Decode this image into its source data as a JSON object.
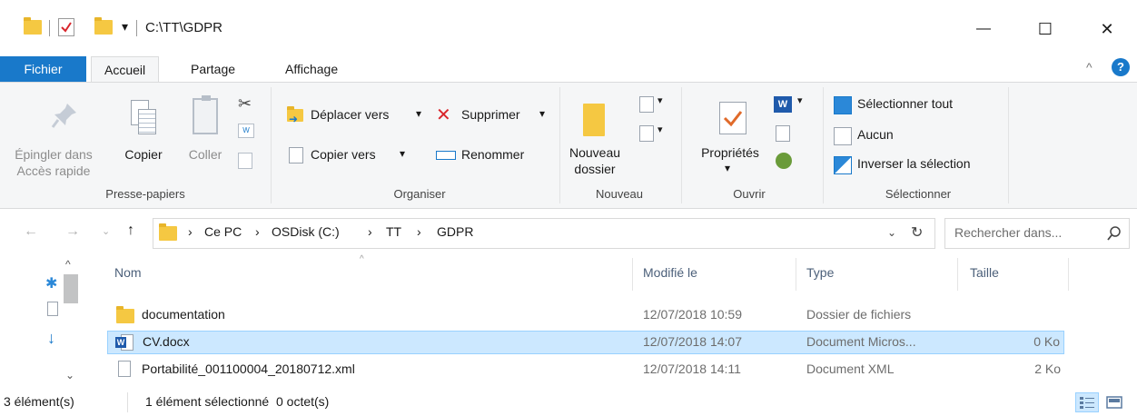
{
  "window": {
    "title": "C:\\TT\\GDPR",
    "qat_dropdown": "▾",
    "controls": {
      "minimize": "—",
      "maximize": "☐",
      "close": "✕"
    }
  },
  "tabs": [
    {
      "label": "Fichier"
    },
    {
      "label": "Accueil"
    },
    {
      "label": "Partage"
    },
    {
      "label": "Affichage"
    }
  ],
  "ribbon": {
    "groups": {
      "clipboard": {
        "label": "Presse-papiers",
        "pin": "Épingler dans\nAccès rapide",
        "pin_line1": "Épingler dans",
        "pin_line2": "Accès rapide",
        "copy": "Copier",
        "paste": "Coller"
      },
      "organize": {
        "label": "Organiser",
        "move_to": "Déplacer vers",
        "copy_to": "Copier vers",
        "delete": "Supprimer",
        "rename": "Renommer",
        "dropdown": "▾"
      },
      "new": {
        "label": "Nouveau",
        "new_folder_line1": "Nouveau",
        "new_folder_line2": "dossier"
      },
      "open": {
        "label": "Ouvrir",
        "properties": "Propriétés",
        "dropdown": "▾"
      },
      "select": {
        "label": "Sélectionner",
        "select_all": "Sélectionner tout",
        "select_none": "Aucun",
        "invert": "Inverser la sélection"
      }
    }
  },
  "address": {
    "crumbs": [
      "Ce PC",
      "OSDisk (C:)",
      "TT",
      "GDPR"
    ],
    "separator": "›",
    "search_placeholder": "Rechercher dans..."
  },
  "columns": {
    "name": "Nom",
    "modified": "Modifié le",
    "type": "Type",
    "size": "Taille"
  },
  "files": [
    {
      "name": "documentation",
      "modified": "12/07/2018 10:59",
      "type": "Dossier de fichiers",
      "size": "",
      "icon": "folder-icon",
      "selected": false
    },
    {
      "name": "CV.docx",
      "modified": "12/07/2018 14:07",
      "type": "Document Micros...",
      "size": "0 Ko",
      "icon": "word-doc-icon",
      "selected": true
    },
    {
      "name": "Portabilité_001100004_20180712.xml",
      "modified": "12/07/2018 14:11",
      "type": "Document XML",
      "size": "2 Ko",
      "icon": "xml-file-icon",
      "selected": false
    }
  ],
  "status": {
    "count": "3 élément(s)",
    "selection": "1 élément sélectionné  0 octet(s)"
  },
  "colors": {
    "file_tab": "#1979ca",
    "selection_bg": "#cce8ff",
    "selection_border": "#99d1ff",
    "folder": "#f5c842",
    "delete_x": "#d9262c",
    "help": "#1979ca"
  }
}
